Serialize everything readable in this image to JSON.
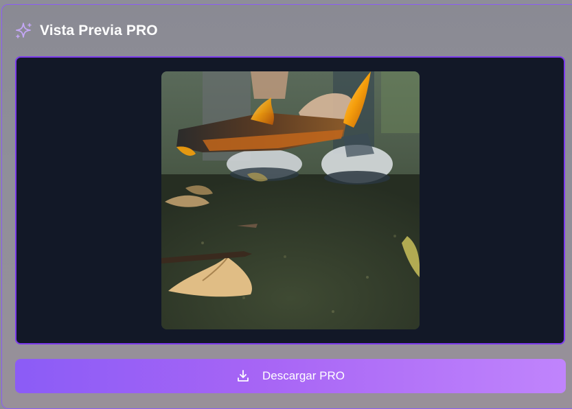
{
  "header": {
    "title": "Vista Previa PRO",
    "icon": "sparkle-icon"
  },
  "preview": {
    "image_description": "burning-paper-photo"
  },
  "actions": {
    "download_label": "Descargar PRO",
    "download_icon": "download-icon"
  },
  "colors": {
    "accent": "#8b5cf6",
    "accent_light": "#c084fc",
    "preview_bg": "#121827"
  }
}
